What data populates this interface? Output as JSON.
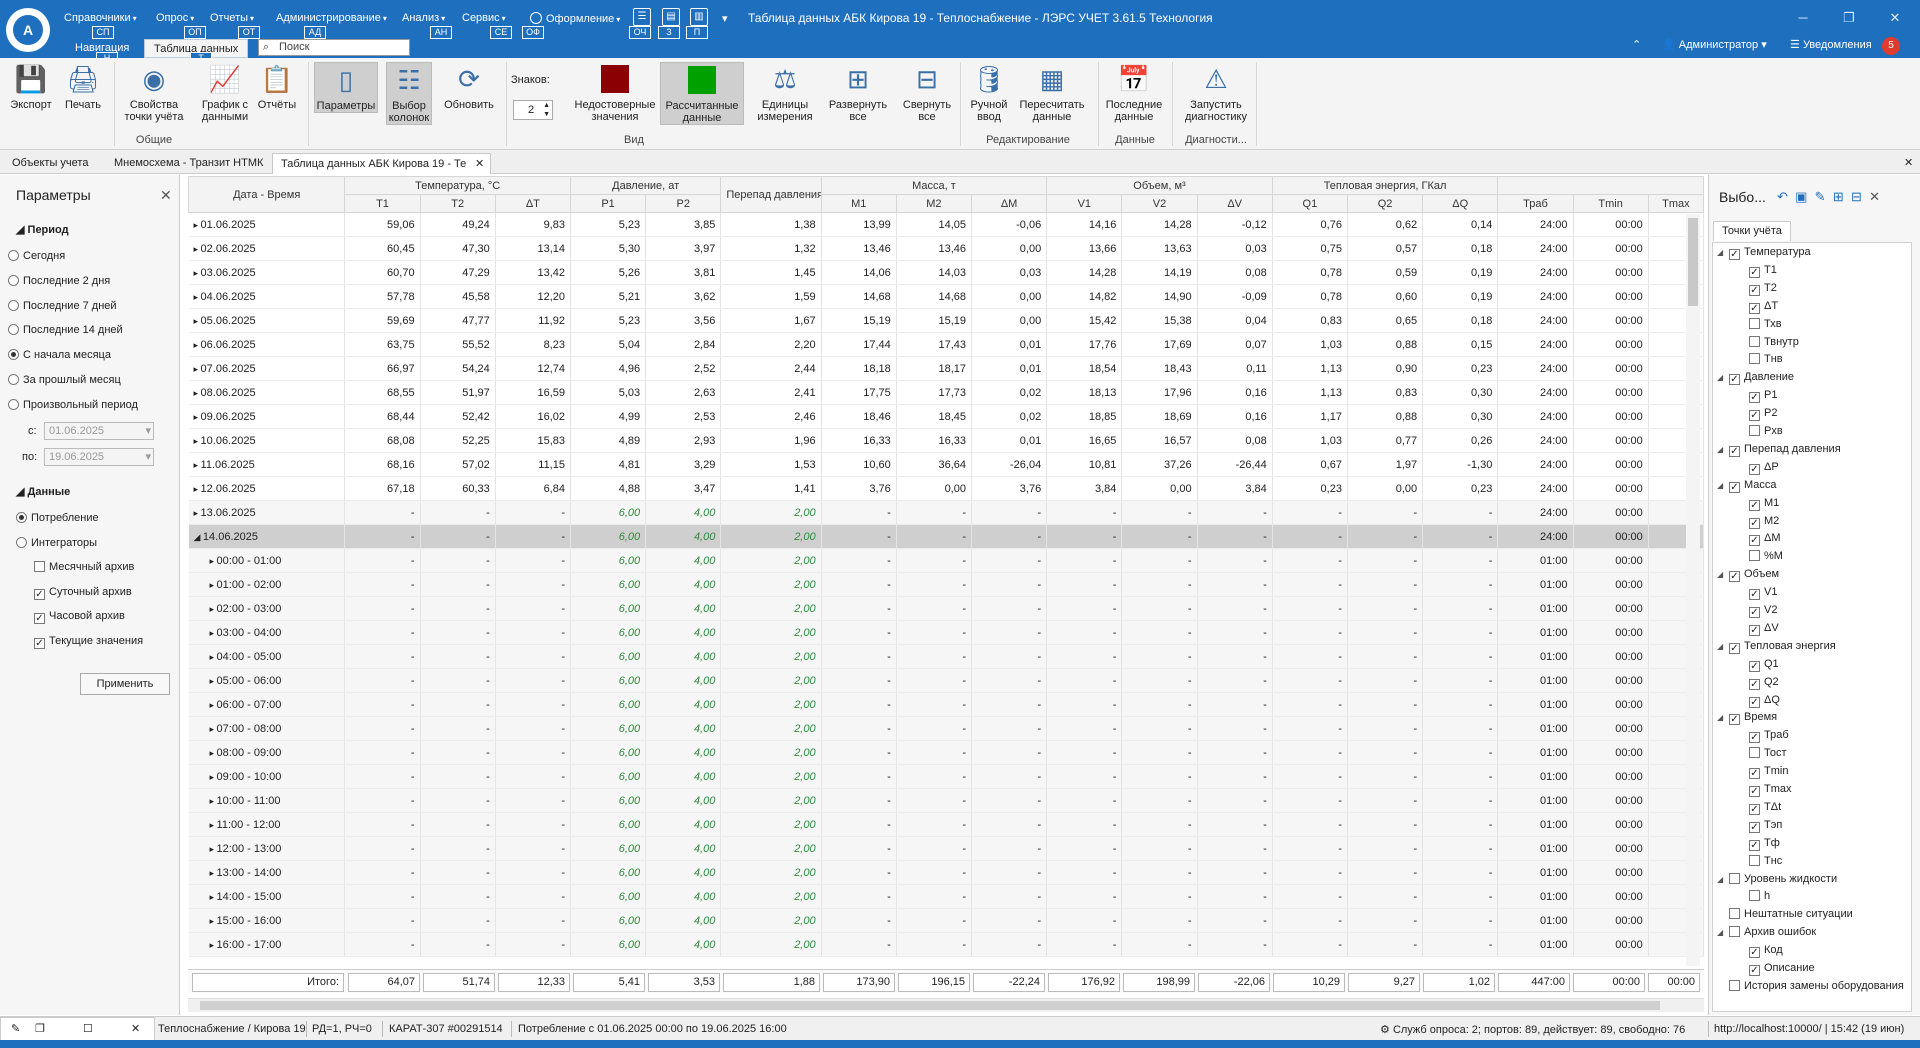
{
  "app": {
    "logo_text": "A",
    "window_title": "Таблица данных АБК Кирова 19 - Теплоснабжение - ЛЭРС УЧЕТ 3.61.5 Технология",
    "menus": [
      {
        "label": "Справочники",
        "key": "СП"
      },
      {
        "label": "Опрос",
        "key": "ОП"
      },
      {
        "label": "Отчеты",
        "key": "ОТ"
      },
      {
        "label": "Администрирование",
        "key": "АД"
      },
      {
        "label": "Анализ",
        "key": "АН"
      },
      {
        "label": "Сервис",
        "key": "СЕ"
      }
    ],
    "design_menu": {
      "label": "Оформление",
      "key": "ОФ"
    },
    "quick_keys": [
      "ОЧ",
      "З",
      "П"
    ],
    "nav_tab": "Навигация",
    "nav_key": "Н",
    "data_tab": "Таблица данных",
    "data_key": "Т",
    "search_placeholder": "Поиск",
    "user": "Администратор",
    "notifications": "Уведомления",
    "notif_count": "5"
  },
  "ribbon": {
    "buttons": [
      {
        "label": "Экспорт",
        "icon": "save-icon"
      },
      {
        "label": "Печать",
        "icon": "printer-icon"
      },
      {
        "label": "Свойства точки учёта",
        "icon": "meter-icon"
      },
      {
        "label": "График с данными",
        "icon": "chart-icon"
      },
      {
        "label": "Отчёты",
        "icon": "report-icon"
      },
      {
        "label": "Параметры",
        "icon": "panel-icon"
      },
      {
        "label": "Выбор колонок",
        "icon": "columns-icon"
      },
      {
        "label": "Обновить",
        "icon": "refresh-icon"
      },
      {
        "label": "Недостоверные значения",
        "icon": "red-square-icon",
        "color": "#8b0000"
      },
      {
        "label": "Рассчитанные данные",
        "icon": "green-square-icon",
        "color": "#00a000"
      },
      {
        "label": "Единицы измерения",
        "icon": "weight-icon"
      },
      {
        "label": "Развернуть все",
        "icon": "expand-icon"
      },
      {
        "label": "Свернуть все",
        "icon": "collapse-icon"
      },
      {
        "label": "Ручной ввод",
        "icon": "manual-input-icon"
      },
      {
        "label": "Пересчитать данные",
        "icon": "calculator-icon"
      },
      {
        "label": "Последние данные",
        "icon": "calendar-icon"
      },
      {
        "label": "Запустить диагностику",
        "icon": "warning-icon"
      }
    ],
    "digits_label": "Знаков:",
    "digits_value": "2",
    "groups": [
      "Общие",
      "Вид",
      "Редактирование",
      "Данные",
      "Диагности..."
    ]
  },
  "doc_tabs": [
    "Объекты учета",
    "Мнемосхема - Транзит  НТМК",
    "Таблица данных АБК Кирова 19 - Те"
  ],
  "params": {
    "title": "Параметры",
    "period_header": "Период",
    "periods": [
      "Сегодня",
      "Последние 2 дня",
      "Последние 7 дней",
      "Последние 14 дней",
      "С начала месяца",
      "За прошлый месяц",
      "Произвольный период"
    ],
    "selected_period": "С начала месяца",
    "from_label": "с:",
    "from_value": "01.06.2025",
    "to_label": "по:",
    "to_value": "19.06.2025",
    "data_header": "Данные",
    "data_options": [
      "Потребление",
      "Интеграторы"
    ],
    "archives": [
      {
        "label": "Месячный архив",
        "checked": false
      },
      {
        "label": "Суточный архив",
        "checked": true
      },
      {
        "label": "Часовой архив",
        "checked": true
      },
      {
        "label": "Текущие значения",
        "checked": true
      }
    ],
    "apply": "Применить"
  },
  "grid": {
    "group_headers": [
      "Дата - Время",
      "Температура, °C",
      "Давление, ат",
      "Перепад давления, ат",
      "Масса, т",
      "Объем, м³",
      "Тепловая энергия, ГКал"
    ],
    "columns": [
      "T1",
      "T2",
      "ΔT",
      "P1",
      "P2",
      "M1",
      "M2",
      "ΔM",
      "V1",
      "V2",
      "ΔV",
      "Q1",
      "Q2",
      "ΔQ",
      "Траб",
      "Tmin",
      "Tmax"
    ],
    "rows": [
      [
        "01.06.2025",
        "59,06",
        "49,24",
        "9,83",
        "5,23",
        "3,85",
        "1,38",
        "13,99",
        "14,05",
        "-0,06",
        "14,16",
        "14,28",
        "-0,12",
        "0,76",
        "0,62",
        "0,14",
        "24:00",
        "00:00",
        ""
      ],
      [
        "02.06.2025",
        "60,45",
        "47,30",
        "13,14",
        "5,30",
        "3,97",
        "1,32",
        "13,46",
        "13,46",
        "0,00",
        "13,66",
        "13,63",
        "0,03",
        "0,75",
        "0,57",
        "0,18",
        "24:00",
        "00:00",
        ""
      ],
      [
        "03.06.2025",
        "60,70",
        "47,29",
        "13,42",
        "5,26",
        "3,81",
        "1,45",
        "14,06",
        "14,03",
        "0,03",
        "14,28",
        "14,19",
        "0,08",
        "0,78",
        "0,59",
        "0,19",
        "24:00",
        "00:00",
        ""
      ],
      [
        "04.06.2025",
        "57,78",
        "45,58",
        "12,20",
        "5,21",
        "3,62",
        "1,59",
        "14,68",
        "14,68",
        "0,00",
        "14,82",
        "14,90",
        "-0,09",
        "0,78",
        "0,60",
        "0,19",
        "24:00",
        "00:00",
        ""
      ],
      [
        "05.06.2025",
        "59,69",
        "47,77",
        "11,92",
        "5,23",
        "3,56",
        "1,67",
        "15,19",
        "15,19",
        "0,00",
        "15,42",
        "15,38",
        "0,04",
        "0,83",
        "0,65",
        "0,18",
        "24:00",
        "00:00",
        ""
      ],
      [
        "06.06.2025",
        "63,75",
        "55,52",
        "8,23",
        "5,04",
        "2,84",
        "2,20",
        "17,44",
        "17,43",
        "0,01",
        "17,76",
        "17,69",
        "0,07",
        "1,03",
        "0,88",
        "0,15",
        "24:00",
        "00:00",
        ""
      ],
      [
        "07.06.2025",
        "66,97",
        "54,24",
        "12,74",
        "4,96",
        "2,52",
        "2,44",
        "18,18",
        "18,17",
        "0,01",
        "18,54",
        "18,43",
        "0,11",
        "1,13",
        "0,90",
        "0,23",
        "24:00",
        "00:00",
        ""
      ],
      [
        "08.06.2025",
        "68,55",
        "51,97",
        "16,59",
        "5,03",
        "2,63",
        "2,41",
        "17,75",
        "17,73",
        "0,02",
        "18,13",
        "17,96",
        "0,16",
        "1,13",
        "0,83",
        "0,30",
        "24:00",
        "00:00",
        ""
      ],
      [
        "09.06.2025",
        "68,44",
        "52,42",
        "16,02",
        "4,99",
        "2,53",
        "2,46",
        "18,46",
        "18,45",
        "0,02",
        "18,85",
        "18,69",
        "0,16",
        "1,17",
        "0,88",
        "0,30",
        "24:00",
        "00:00",
        ""
      ],
      [
        "10.06.2025",
        "68,08",
        "52,25",
        "15,83",
        "4,89",
        "2,93",
        "1,96",
        "16,33",
        "16,33",
        "0,01",
        "16,65",
        "16,57",
        "0,08",
        "1,03",
        "0,77",
        "0,26",
        "24:00",
        "00:00",
        ""
      ],
      [
        "11.06.2025",
        "68,16",
        "57,02",
        "11,15",
        "4,81",
        "3,29",
        "1,53",
        "10,60",
        "36,64",
        "-26,04",
        "10,81",
        "37,26",
        "-26,44",
        "0,67",
        "1,97",
        "-1,30",
        "24:00",
        "00:00",
        ""
      ],
      [
        "12.06.2025",
        "67,18",
        "60,33",
        "6,84",
        "4,88",
        "3,47",
        "1,41",
        "3,76",
        "0,00",
        "3,76",
        "3,84",
        "0,00",
        "3,84",
        "0,23",
        "0,00",
        "0,23",
        "24:00",
        "00:00",
        ""
      ],
      [
        "13.06.2025",
        "-",
        "-",
        "-",
        "6,00",
        "4,00",
        "2,00",
        "-",
        "-",
        "-",
        "-",
        "-",
        "-",
        "-",
        "-",
        "-",
        "24:00",
        "00:00",
        ""
      ],
      [
        "14.06.2025",
        "-",
        "-",
        "-",
        "6,00",
        "4,00",
        "2,00",
        "-",
        "-",
        "-",
        "-",
        "-",
        "-",
        "-",
        "-",
        "-",
        "24:00",
        "00:00",
        ""
      ],
      [
        "00:00 - 01:00",
        "-",
        "-",
        "-",
        "6,00",
        "4,00",
        "2,00",
        "-",
        "-",
        "-",
        "-",
        "-",
        "-",
        "-",
        "-",
        "-",
        "01:00",
        "00:00",
        ""
      ],
      [
        "01:00 - 02:00",
        "-",
        "-",
        "-",
        "6,00",
        "4,00",
        "2,00",
        "-",
        "-",
        "-",
        "-",
        "-",
        "-",
        "-",
        "-",
        "-",
        "01:00",
        "00:00",
        ""
      ],
      [
        "02:00 - 03:00",
        "-",
        "-",
        "-",
        "6,00",
        "4,00",
        "2,00",
        "-",
        "-",
        "-",
        "-",
        "-",
        "-",
        "-",
        "-",
        "-",
        "01:00",
        "00:00",
        ""
      ],
      [
        "03:00 - 04:00",
        "-",
        "-",
        "-",
        "6,00",
        "4,00",
        "2,00",
        "-",
        "-",
        "-",
        "-",
        "-",
        "-",
        "-",
        "-",
        "-",
        "01:00",
        "00:00",
        ""
      ],
      [
        "04:00 - 05:00",
        "-",
        "-",
        "-",
        "6,00",
        "4,00",
        "2,00",
        "-",
        "-",
        "-",
        "-",
        "-",
        "-",
        "-",
        "-",
        "-",
        "01:00",
        "00:00",
        ""
      ],
      [
        "05:00 - 06:00",
        "-",
        "-",
        "-",
        "6,00",
        "4,00",
        "2,00",
        "-",
        "-",
        "-",
        "-",
        "-",
        "-",
        "-",
        "-",
        "-",
        "01:00",
        "00:00",
        ""
      ],
      [
        "06:00 - 07:00",
        "-",
        "-",
        "-",
        "6,00",
        "4,00",
        "2,00",
        "-",
        "-",
        "-",
        "-",
        "-",
        "-",
        "-",
        "-",
        "-",
        "01:00",
        "00:00",
        ""
      ],
      [
        "07:00 - 08:00",
        "-",
        "-",
        "-",
        "6,00",
        "4,00",
        "2,00",
        "-",
        "-",
        "-",
        "-",
        "-",
        "-",
        "-",
        "-",
        "-",
        "01:00",
        "00:00",
        ""
      ],
      [
        "08:00 - 09:00",
        "-",
        "-",
        "-",
        "6,00",
        "4,00",
        "2,00",
        "-",
        "-",
        "-",
        "-",
        "-",
        "-",
        "-",
        "-",
        "-",
        "01:00",
        "00:00",
        ""
      ],
      [
        "09:00 - 10:00",
        "-",
        "-",
        "-",
        "6,00",
        "4,00",
        "2,00",
        "-",
        "-",
        "-",
        "-",
        "-",
        "-",
        "-",
        "-",
        "-",
        "01:00",
        "00:00",
        ""
      ],
      [
        "10:00 - 11:00",
        "-",
        "-",
        "-",
        "6,00",
        "4,00",
        "2,00",
        "-",
        "-",
        "-",
        "-",
        "-",
        "-",
        "-",
        "-",
        "-",
        "01:00",
        "00:00",
        ""
      ],
      [
        "11:00 - 12:00",
        "-",
        "-",
        "-",
        "6,00",
        "4,00",
        "2,00",
        "-",
        "-",
        "-",
        "-",
        "-",
        "-",
        "-",
        "-",
        "-",
        "01:00",
        "00:00",
        ""
      ],
      [
        "12:00 - 13:00",
        "-",
        "-",
        "-",
        "6,00",
        "4,00",
        "2,00",
        "-",
        "-",
        "-",
        "-",
        "-",
        "-",
        "-",
        "-",
        "-",
        "01:00",
        "00:00",
        ""
      ],
      [
        "13:00 - 14:00",
        "-",
        "-",
        "-",
        "6,00",
        "4,00",
        "2,00",
        "-",
        "-",
        "-",
        "-",
        "-",
        "-",
        "-",
        "-",
        "-",
        "01:00",
        "00:00",
        ""
      ],
      [
        "14:00 - 15:00",
        "-",
        "-",
        "-",
        "6,00",
        "4,00",
        "2,00",
        "-",
        "-",
        "-",
        "-",
        "-",
        "-",
        "-",
        "-",
        "-",
        "01:00",
        "00:00",
        ""
      ],
      [
        "15:00 - 16:00",
        "-",
        "-",
        "-",
        "6,00",
        "4,00",
        "2,00",
        "-",
        "-",
        "-",
        "-",
        "-",
        "-",
        "-",
        "-",
        "-",
        "01:00",
        "00:00",
        ""
      ],
      [
        "16:00 - 17:00",
        "-",
        "-",
        "-",
        "6,00",
        "4,00",
        "2,00",
        "-",
        "-",
        "-",
        "-",
        "-",
        "-",
        "-",
        "-",
        "-",
        "01:00",
        "00:00",
        ""
      ]
    ],
    "selected_row": "14.06.2025",
    "totals_label": "Итого:",
    "totals": [
      "64,07",
      "51,74",
      "12,33",
      "5,41",
      "3,53",
      "1,88",
      "173,90",
      "196,15",
      "-22,24",
      "176,92",
      "198,99",
      "-22,06",
      "10,29",
      "9,27",
      "1,02",
      "447:00",
      "00:00",
      "00:00"
    ]
  },
  "columns_panel": {
    "title": "Выбо...",
    "tab": "Точки учёта",
    "tree": [
      {
        "label": "Температура",
        "level": 0,
        "checked": true,
        "exp": true
      },
      {
        "label": "T1",
        "level": 1,
        "checked": true
      },
      {
        "label": "T2",
        "level": 1,
        "checked": true
      },
      {
        "label": "ΔT",
        "level": 1,
        "checked": true
      },
      {
        "label": "Тхв",
        "level": 1,
        "checked": false
      },
      {
        "label": "Твнутр",
        "level": 1,
        "checked": false
      },
      {
        "label": "Тнв",
        "level": 1,
        "checked": false
      },
      {
        "label": "Давление",
        "level": 0,
        "checked": true,
        "exp": true
      },
      {
        "label": "P1",
        "level": 1,
        "checked": true
      },
      {
        "label": "P2",
        "level": 1,
        "checked": true
      },
      {
        "label": "Pхв",
        "level": 1,
        "checked": false
      },
      {
        "label": "Перепад давления",
        "level": 0,
        "checked": true,
        "exp": true
      },
      {
        "label": "ΔP",
        "level": 1,
        "checked": true
      },
      {
        "label": "Масса",
        "level": 0,
        "checked": true,
        "exp": true
      },
      {
        "label": "M1",
        "level": 1,
        "checked": true
      },
      {
        "label": "M2",
        "level": 1,
        "checked": true
      },
      {
        "label": "ΔM",
        "level": 1,
        "checked": true
      },
      {
        "label": "%M",
        "level": 1,
        "checked": false
      },
      {
        "label": "Объем",
        "level": 0,
        "checked": true,
        "exp": true
      },
      {
        "label": "V1",
        "level": 1,
        "checked": true
      },
      {
        "label": "V2",
        "level": 1,
        "checked": true
      },
      {
        "label": "ΔV",
        "level": 1,
        "checked": true
      },
      {
        "label": "Тепловая энергия",
        "level": 0,
        "checked": true,
        "exp": true
      },
      {
        "label": "Q1",
        "level": 1,
        "checked": true
      },
      {
        "label": "Q2",
        "level": 1,
        "checked": true
      },
      {
        "label": "ΔQ",
        "level": 1,
        "checked": true
      },
      {
        "label": "Время",
        "level": 0,
        "checked": true,
        "exp": true
      },
      {
        "label": "Траб",
        "level": 1,
        "checked": true
      },
      {
        "label": "Тост",
        "level": 1,
        "checked": false
      },
      {
        "label": "Tmin",
        "level": 1,
        "checked": true
      },
      {
        "label": "Tmax",
        "level": 1,
        "checked": true
      },
      {
        "label": "TΔt",
        "level": 1,
        "checked": true
      },
      {
        "label": "Тэп",
        "level": 1,
        "checked": true
      },
      {
        "label": "Тф",
        "level": 1,
        "checked": true
      },
      {
        "label": "Тнс",
        "level": 1,
        "checked": false
      },
      {
        "label": "Уровень жидкости",
        "level": 0,
        "checked": false,
        "exp": true
      },
      {
        "label": "h",
        "level": 1,
        "checked": false
      },
      {
        "label": "Нештатные ситуации",
        "level": 0,
        "checked": false,
        "exp": false
      },
      {
        "label": "Архив ошибок",
        "level": 0,
        "checked": false,
        "exp": true
      },
      {
        "label": "Код",
        "level": 1,
        "checked": true
      },
      {
        "label": "Описание",
        "level": 1,
        "checked": true
      },
      {
        "label": "История замены оборудования",
        "level": 0,
        "checked": false,
        "exp": false
      }
    ]
  },
  "status": {
    "object": "Теплоснабжение / Кирова 19",
    "rd": "РД=1, РЧ=0",
    "device": "КАРАТ-307 #00291514",
    "period": "Потребление с 01.06.2025 00:00 по 19.06.2025 16:00",
    "survey": "Служб опроса: 2; портов: 89, действует: 89, свободно: 76",
    "server": "http://localhost:10000/ | 15:42 (19 июн)"
  },
  "colors": {
    "titlebar": "#1f6fbf",
    "calc_value": "#2e8b3a",
    "invalid": "#8b0000",
    "calculated": "#00a000",
    "notif": "#e03c2e"
  }
}
